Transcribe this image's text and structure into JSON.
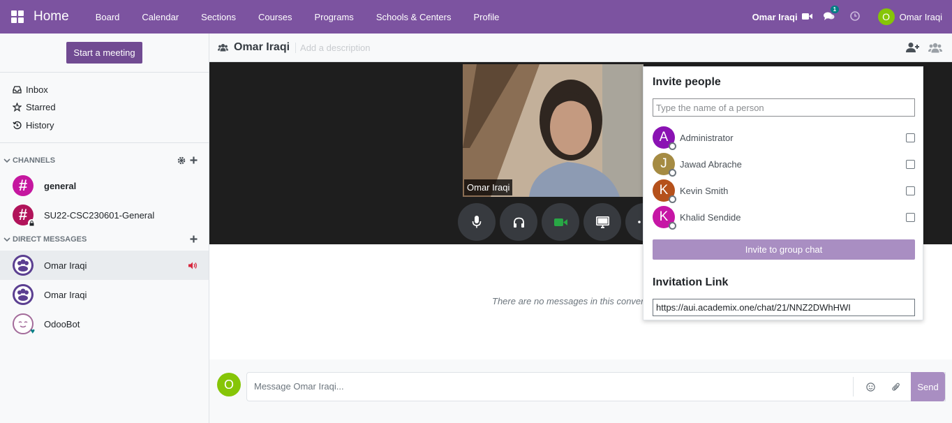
{
  "topbar": {
    "brand": "Home",
    "menu": [
      "Board",
      "Calendar",
      "Sections",
      "Courses",
      "Programs",
      "Schools & Centers",
      "Profile"
    ],
    "call_name": "Omar Iraqi",
    "chat_badge": "1",
    "user_initial": "O",
    "user_name": "Omar Iraqi",
    "colors": {
      "bar": "#7c53a0",
      "avatar": "#86c507"
    }
  },
  "sidebar": {
    "start_meeting": "Start a meeting",
    "nav": [
      {
        "label": "Inbox",
        "icon": "inbox-icon"
      },
      {
        "label": "Starred",
        "icon": "star-icon"
      },
      {
        "label": "History",
        "icon": "history-icon"
      }
    ],
    "channels_header": "CHANNELS",
    "channels": [
      {
        "label": "general",
        "color": "#c5179f",
        "bold": true
      },
      {
        "label": "SU22-CSC230601-General",
        "color": "#b1135a",
        "bold": false
      }
    ],
    "dm_header": "DIRECT MESSAGES",
    "dms": [
      {
        "label": "Omar Iraqi",
        "in_call": true
      },
      {
        "label": "Omar Iraqi",
        "in_call": false
      },
      {
        "label": "OdooBot",
        "in_call": false
      }
    ]
  },
  "main": {
    "title": "Omar Iraqi",
    "description_placeholder": "Add a description",
    "video_label": "Omar Iraqi",
    "empty_text": "There are no messages in this conver",
    "composer_initial": "O",
    "composer_placeholder": "Message Omar Iraqi...",
    "send": "Send"
  },
  "invite": {
    "title": "Invite people",
    "search_placeholder": "Type the name of a person",
    "people": [
      {
        "initial": "A",
        "name": "Administrator",
        "color": "#8a12b3"
      },
      {
        "initial": "J",
        "name": "Jawad Abrache",
        "color": "#a58b43"
      },
      {
        "initial": "K",
        "name": "Kevin Smith",
        "color": "#b5511b"
      },
      {
        "initial": "K",
        "name": "Khalid Sendide",
        "color": "#c616a5"
      }
    ],
    "invite_button": "Invite to group chat",
    "link_title": "Invitation Link",
    "link": "https://aui.academix.one/chat/21/NNZ2DWhHWI"
  }
}
